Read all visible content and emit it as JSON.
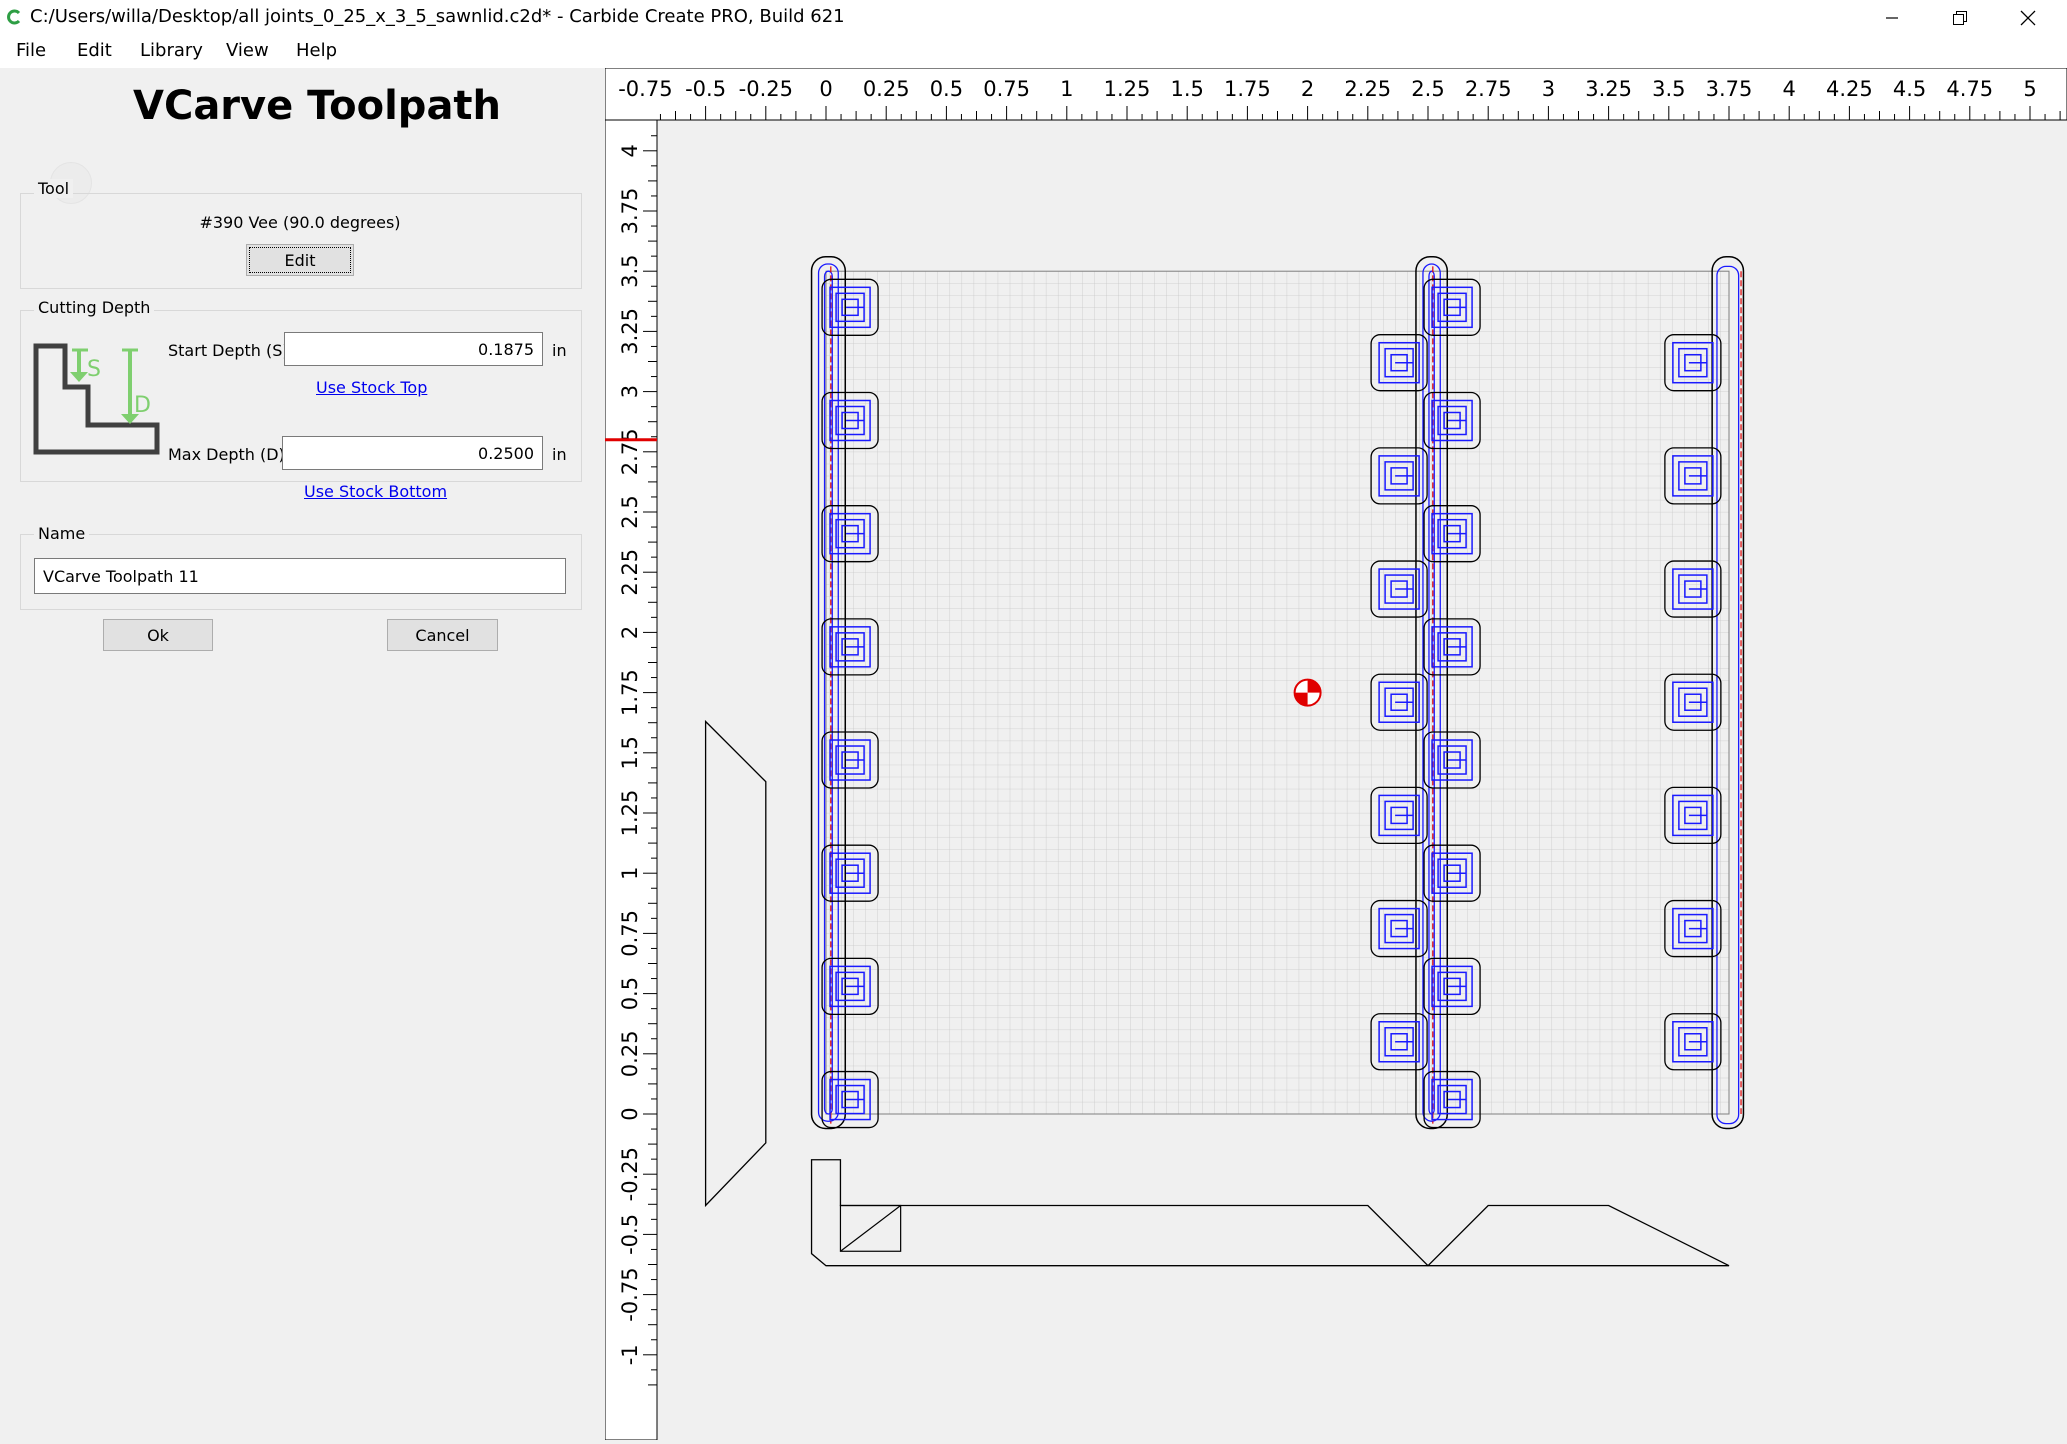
{
  "window": {
    "title": "C:/Users/willa/Desktop/all joints_0_25_x_3_5_sawnlid.c2d* - Carbide Create PRO, Build 621",
    "minimize_icon": "minimize-icon",
    "restore_icon": "restore-icon",
    "close_icon": "close-icon"
  },
  "menu": {
    "file": "File",
    "edit": "Edit",
    "library": "Library",
    "view": "View",
    "help": "Help"
  },
  "panel": {
    "title": "VCarve Toolpath",
    "tool": {
      "group_label": "Tool",
      "name": "#390 Vee (90.0 degrees)",
      "edit_label": "Edit"
    },
    "depth": {
      "group_label": "Cutting Depth",
      "start_label": "Start Depth (S)",
      "start_value": "0.1875",
      "start_unit": "in",
      "use_top_label": "Use Stock Top",
      "max_label": "Max Depth (D)",
      "max_value": "0.2500",
      "max_unit": "in",
      "use_bottom_label": "Use Stock Bottom",
      "diagram_s": "S",
      "diagram_d": "D"
    },
    "name": {
      "group_label": "Name",
      "value": "VCarve Toolpath 11"
    },
    "ok_label": "Ok",
    "cancel_label": "Cancel"
  },
  "ruler": {
    "top_labels": [
      "-0.75",
      "-0.5",
      "-0.25",
      "0",
      "0.25",
      "0.5",
      "0.75",
      "1",
      "1.25",
      "1.5",
      "1.75",
      "2",
      "2.25",
      "2.5",
      "2.75",
      "3",
      "3.25",
      "3.5",
      "3.75",
      "4",
      "4.25",
      "4.5",
      "4.75",
      "5"
    ],
    "left_labels": [
      "4",
      "3.75",
      "3.5",
      "3.25",
      "3",
      "2.75",
      "2.5",
      "2.25",
      "2",
      "1.75",
      "1.5",
      "1.25",
      "1",
      "0.75",
      "0.5",
      "0.25",
      "0",
      "-0.25",
      "-0.5",
      "-0.75",
      "-1"
    ]
  },
  "colors": {
    "toolpath_blue": "#1a1aff",
    "highlight_red": "#e00000",
    "diagram_green": "#7fcf6f",
    "link_blue": "#0000ee"
  }
}
